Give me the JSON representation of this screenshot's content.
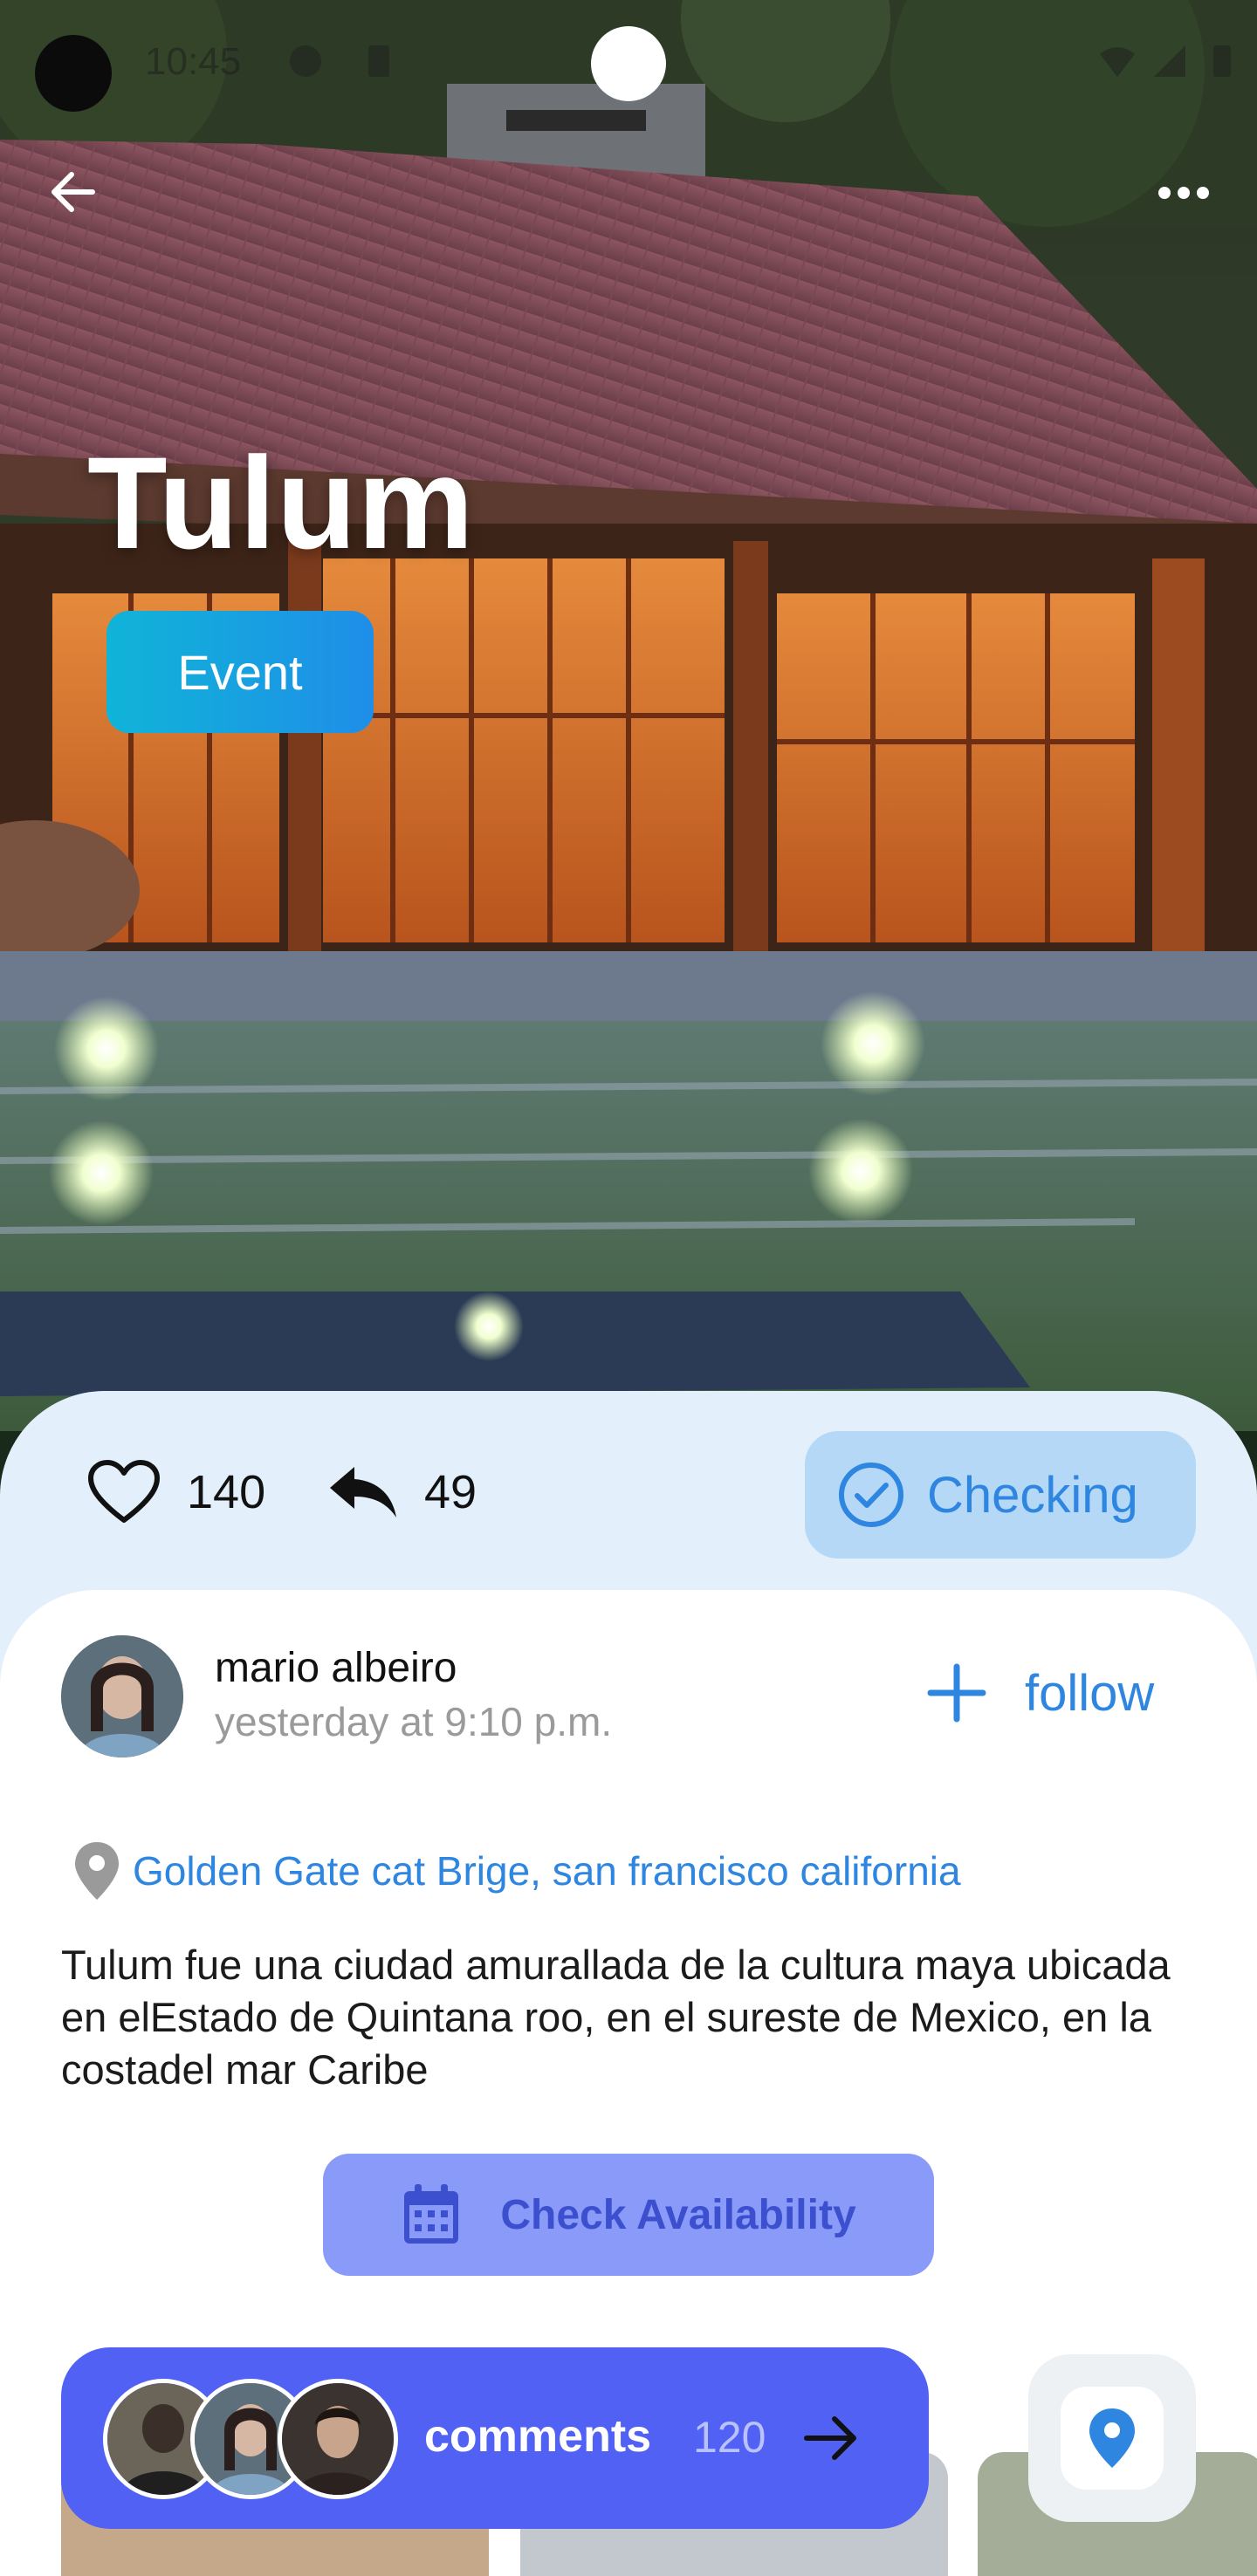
{
  "status_bar": {
    "time": "10:45"
  },
  "hero": {
    "title": "Tulum",
    "tag": "Event"
  },
  "icons": {
    "back": "arrow-left-icon",
    "more": "more-horizontal-icon",
    "like": "heart-icon",
    "share": "reply-icon",
    "checking": "check-circle-icon",
    "follow": "plus-icon",
    "location": "map-pin-icon",
    "availability": "calendar-icon",
    "comments": "arrow-right-icon",
    "map": "location-pin-icon"
  },
  "stats": {
    "likes": "140",
    "shares": "49",
    "checking_label": "Checking"
  },
  "post": {
    "author_name": "mario albeiro",
    "author_time": "yesterday at 9:10 p.m.",
    "follow_label": "follow",
    "location": "Golden Gate cat Brige, san francisco california",
    "description": "Tulum fue una ciudad amurallada de la cultura maya ubicada en elEstado de Quintana roo, en el sureste de Mexico, en la costadel mar Caribe",
    "availability_label": "Check Availability"
  },
  "comments": {
    "label": "comments",
    "count": "120"
  },
  "colors": {
    "accent_blue": "#2e86e0",
    "event_chip": "#14a8dc",
    "stats_sheet": "#e3f0fc",
    "checking_bg": "#b6d8f7",
    "availability_bg": "#8a9af9",
    "availability_text": "#3c4fcf",
    "comments_bar": "#5161f4"
  }
}
